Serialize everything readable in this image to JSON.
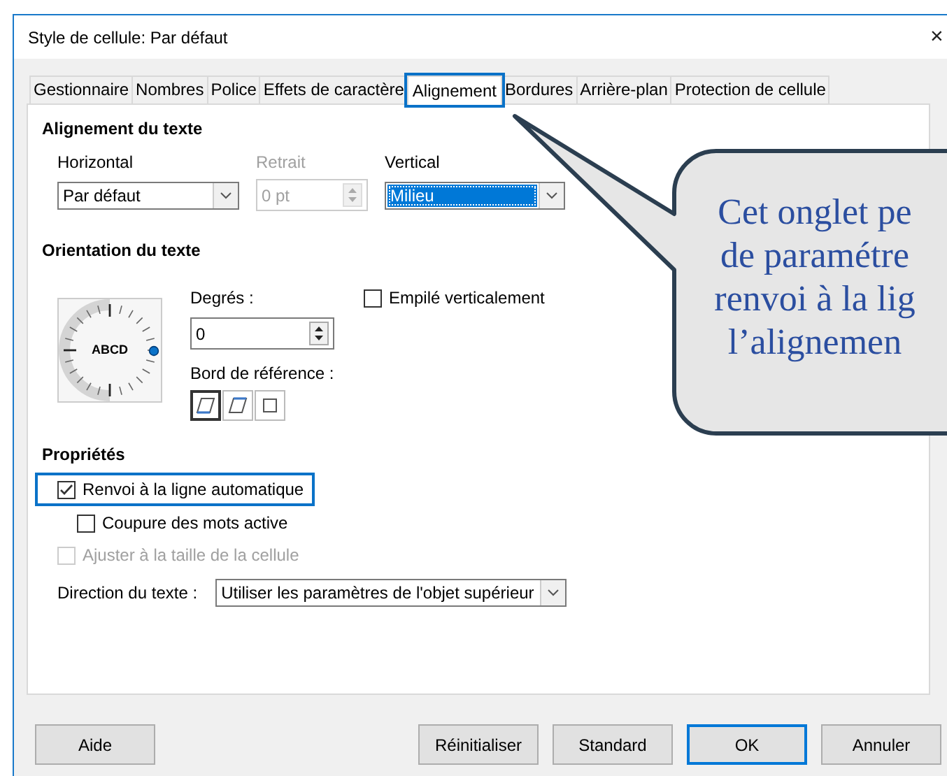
{
  "window": {
    "title": "Style de cellule: Par défaut",
    "close": "×"
  },
  "tabs": [
    {
      "label": "Gestionnaire",
      "selected": false,
      "highlighted": false
    },
    {
      "label": "Nombres",
      "selected": false,
      "highlighted": false
    },
    {
      "label": "Police",
      "selected": false,
      "highlighted": false
    },
    {
      "label": "Effets de caractère",
      "selected": false,
      "highlighted": false
    },
    {
      "label": "Alignement",
      "selected": true,
      "highlighted": true
    },
    {
      "label": "Bordures",
      "selected": false,
      "highlighted": false
    },
    {
      "label": "Arrière-plan",
      "selected": false,
      "highlighted": false
    },
    {
      "label": "Protection de cellule",
      "selected": false,
      "highlighted": false
    }
  ],
  "text_alignment": {
    "heading": "Alignement du texte",
    "horizontal": {
      "label": "Horizontal",
      "value": "Par défaut",
      "focused": false,
      "disabled": false
    },
    "indent": {
      "label": "Retrait",
      "value": "0 pt",
      "disabled": true
    },
    "vertical": {
      "label": "Vertical",
      "value": "Milieu",
      "focused": true,
      "disabled": false
    }
  },
  "text_orientation": {
    "heading": "Orientation du texte",
    "dial_sample": "ABCD",
    "degrees": {
      "label": "Degrés :",
      "value": "0",
      "disabled": false
    },
    "reference_edge": {
      "label": "Bord de référence :",
      "options": [
        {
          "kind": "bottom",
          "selected": true
        },
        {
          "kind": "top",
          "selected": false
        },
        {
          "kind": "cell",
          "selected": false
        }
      ]
    },
    "stacked": {
      "label": "Empilé verticalement",
      "checked": false,
      "disabled": false
    }
  },
  "properties": {
    "heading": "Propriétés",
    "checkboxes": [
      {
        "label": "Renvoi à la ligne automatique",
        "checked": true,
        "disabled": false,
        "indented": false,
        "highlighted": true
      },
      {
        "label": "Coupure des mots active",
        "checked": false,
        "disabled": false,
        "indented": true,
        "highlighted": false
      },
      {
        "label": "Ajuster à la taille de la cellule",
        "checked": false,
        "disabled": true,
        "indented": false,
        "highlighted": false
      }
    ],
    "direction": {
      "label": "Direction du texte :",
      "value": "Utiliser les paramètres de l'objet supérieur",
      "focused": false,
      "disabled": false
    }
  },
  "buttons": [
    {
      "label": "Aide",
      "default": false
    },
    {
      "label": "Réinitialiser",
      "default": false
    },
    {
      "label": "Standard",
      "default": false
    },
    {
      "label": "OK",
      "default": true
    },
    {
      "label": "Annuler",
      "default": false
    }
  ],
  "callout": {
    "lines": [
      "Cet onglet pe",
      "de paramétre",
      "renvoi à la lig",
      "l’alignemen"
    ]
  }
}
